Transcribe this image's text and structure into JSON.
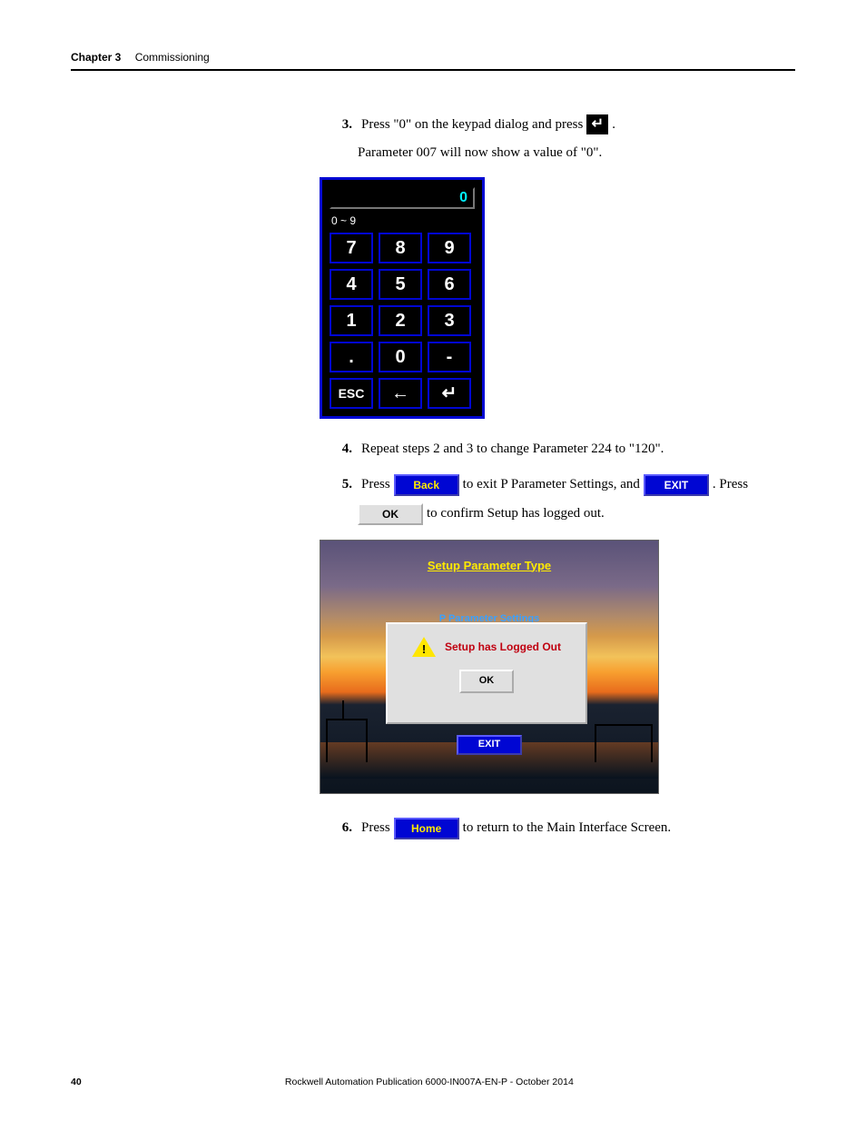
{
  "header": {
    "chapter": "Chapter 3",
    "title": "Commissioning"
  },
  "icons": {
    "enter_glyph": "↵"
  },
  "steps": {
    "s3": {
      "num": "3.",
      "line1_a": "Press \"0\" on the keypad dialog and press",
      "line1_b": ".",
      "line2": "Parameter 007 will now show a value of \"0\"."
    },
    "s4": {
      "num": "4.",
      "text": "Repeat steps 2 and 3 to change Parameter 224 to \"120\"."
    },
    "s5": {
      "num": "5.",
      "a": "Press",
      "b": "to exit P Parameter Settings, and",
      "c": ". Press",
      "d": "to confirm Setup has logged out.",
      "back": "Back",
      "exit": "EXIT",
      "ok": "OK"
    },
    "s6": {
      "num": "6.",
      "a": "Press",
      "b": "to return to the Main Interface Screen.",
      "home": "Home"
    }
  },
  "keypad": {
    "display": "0",
    "range": "0 ~ 9",
    "keys": [
      "7",
      "8",
      "9",
      "4",
      "5",
      "6",
      "1",
      "2",
      "3",
      ".",
      "0",
      "-",
      "ESC",
      "←",
      "↵"
    ]
  },
  "hmi": {
    "title": "Setup Parameter Type",
    "subtitle": "P Parameter Settings",
    "dialog_msg": "Setup has Logged Out",
    "dialog_ok": "OK",
    "exit": "EXIT"
  },
  "footer": {
    "page": "40",
    "pub": "Rockwell Automation Publication 6000-IN007A-EN-P - October 2014"
  }
}
